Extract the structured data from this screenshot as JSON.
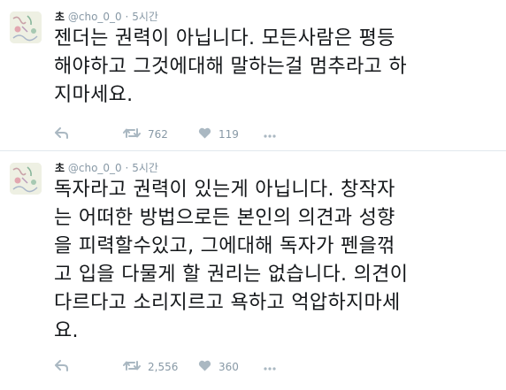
{
  "tweets": [
    {
      "name": "초",
      "handle": "@cho_0_0",
      "separator": "·",
      "time": "5시간",
      "lines": [
        "젠더는 권력이 아닙니다. 모든사람은 평등",
        "해야하고 그것에대해 말하는걸 멈추라고 하",
        "지마세요."
      ],
      "retweets": "762",
      "likes": "119"
    },
    {
      "name": "초",
      "handle": "@cho_0_0",
      "separator": "·",
      "time": "5시간",
      "lines": [
        "독자라고 권력이 있는게 아닙니다. 창작자",
        "는 어떠한 방법으로든 본인의 의견과 성향",
        "을 피력할수있고, 그에대해 독자가 펜을꺾",
        "고 입을 다물게 할 권리는 없습니다. 의견이",
        "다르다고 소리지르고 욕하고 억압하지마세",
        "요."
      ],
      "retweets": "2,556",
      "likes": "360"
    }
  ],
  "icons": {
    "reply": "reply-icon",
    "retweet": "retweet-icon",
    "like": "heart-icon",
    "more": "more-icon"
  },
  "colors": {
    "text": "#14171a",
    "meta": "#8899a6",
    "divider": "#e1e8ed"
  }
}
